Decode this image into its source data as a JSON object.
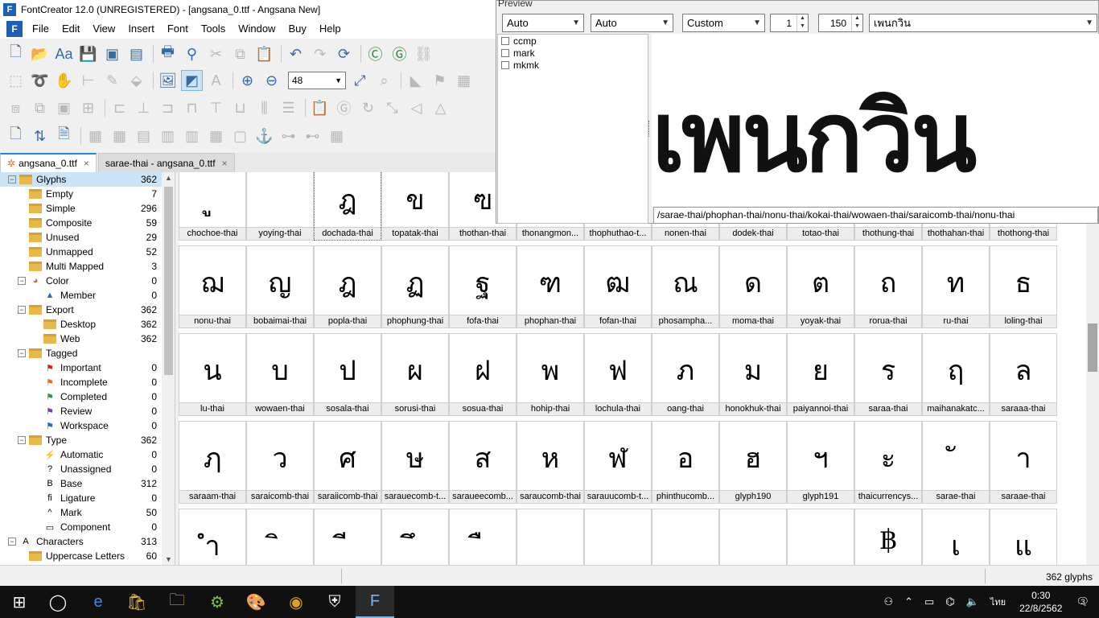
{
  "window": {
    "title": "FontCreator 12.0 (UNREGISTERED) - [angsana_0.ttf - Angsana New]"
  },
  "menu": [
    "File",
    "Edit",
    "View",
    "Insert",
    "Font",
    "Tools",
    "Window",
    "Buy",
    "Help"
  ],
  "toolbar": {
    "zoom": "48"
  },
  "tabs": [
    {
      "label": "angsana_0.ttf",
      "close": "×"
    },
    {
      "label": "sarae-thai - angsana_0.ttf",
      "close": "×"
    }
  ],
  "tree": [
    {
      "label": "Glyphs",
      "count": "362",
      "level": 1,
      "exp": "−",
      "icon": "folder",
      "sel": true
    },
    {
      "label": "Empty",
      "count": "7",
      "level": 2,
      "icon": "folder"
    },
    {
      "label": "Simple",
      "count": "296",
      "level": 2,
      "icon": "folder"
    },
    {
      "label": "Composite",
      "count": "59",
      "level": 2,
      "icon": "folder"
    },
    {
      "label": "Unused",
      "count": "29",
      "level": 2,
      "icon": "folder"
    },
    {
      "label": "Unmapped",
      "count": "52",
      "level": 2,
      "icon": "folder"
    },
    {
      "label": "Multi Mapped",
      "count": "3",
      "level": 2,
      "icon": "folder"
    },
    {
      "label": "Color",
      "count": "0",
      "level": 2,
      "exp": "−",
      "icon": "color-wheel"
    },
    {
      "label": "Member",
      "count": "0",
      "level": 3,
      "icon": "triangle"
    },
    {
      "label": "Export",
      "count": "362",
      "level": 2,
      "exp": "−",
      "icon": "folder"
    },
    {
      "label": "Desktop",
      "count": "362",
      "level": 3,
      "icon": "folder"
    },
    {
      "label": "Web",
      "count": "362",
      "level": 3,
      "icon": "folder"
    },
    {
      "label": "Tagged",
      "count": "",
      "level": 2,
      "exp": "−",
      "icon": "folder"
    },
    {
      "label": "Important",
      "count": "0",
      "level": 3,
      "icon": "flag-red"
    },
    {
      "label": "Incomplete",
      "count": "0",
      "level": 3,
      "icon": "flag-orange"
    },
    {
      "label": "Completed",
      "count": "0",
      "level": 3,
      "icon": "flag-green"
    },
    {
      "label": "Review",
      "count": "0",
      "level": 3,
      "icon": "flag-purple"
    },
    {
      "label": "Workspace",
      "count": "0",
      "level": 3,
      "icon": "flag-blue"
    },
    {
      "label": "Type",
      "count": "362",
      "level": 2,
      "exp": "−",
      "icon": "folder"
    },
    {
      "label": "Automatic",
      "count": "0",
      "level": 3,
      "icon": "bolt"
    },
    {
      "label": "Unassigned",
      "count": "0",
      "level": 3,
      "icon": "question"
    },
    {
      "label": "Base",
      "count": "312",
      "level": 3,
      "icon": "base"
    },
    {
      "label": "Ligature",
      "count": "0",
      "level": 3,
      "icon": "ligature"
    },
    {
      "label": "Mark",
      "count": "50",
      "level": 3,
      "icon": "caret"
    },
    {
      "label": "Component",
      "count": "0",
      "level": 3,
      "icon": "component"
    },
    {
      "label": "Characters",
      "count": "313",
      "level": 1,
      "exp": "−",
      "icon": "letter-a"
    },
    {
      "label": "Uppercase Letters",
      "count": "60",
      "level": 2,
      "icon": "folder"
    }
  ],
  "grid": {
    "rows": [
      [
        {
          "g": "ู",
          "n": "chochoe-thai"
        },
        {
          "g": "",
          "n": "yoying-thai"
        },
        {
          "g": "ฎ",
          "n": "dochada-thai",
          "sel": true
        },
        {
          "g": "ข",
          "n": "topatak-thai"
        },
        {
          "g": "ฃ",
          "n": "thothan-thai"
        },
        {
          "g": "",
          "n": "thonangmon..."
        },
        {
          "g": "",
          "n": "thophuthao-t..."
        },
        {
          "g": "",
          "n": "nonen-thai"
        },
        {
          "g": "",
          "n": "dodek-thai"
        },
        {
          "g": "",
          "n": "totao-thai"
        },
        {
          "g": "",
          "n": "thothung-thai"
        },
        {
          "g": "",
          "n": "thothahan-thai"
        },
        {
          "g": "",
          "n": "thothong-thai"
        }
      ],
      [
        {
          "g": "ฌ",
          "n": "nonu-thai"
        },
        {
          "g": "ญ",
          "n": "bobaimai-thai"
        },
        {
          "g": "ฎ",
          "n": "popla-thai"
        },
        {
          "g": "ฏ",
          "n": "phophung-thai"
        },
        {
          "g": "ฐ",
          "n": "fofa-thai"
        },
        {
          "g": "ฑ",
          "n": "phophan-thai"
        },
        {
          "g": "ฒ",
          "n": "fofan-thai"
        },
        {
          "g": "ณ",
          "n": "phosampha..."
        },
        {
          "g": "ด",
          "n": "moma-thai"
        },
        {
          "g": "ต",
          "n": "yoyak-thai"
        },
        {
          "g": "ถ",
          "n": "rorua-thai"
        },
        {
          "g": "ท",
          "n": "ru-thai"
        },
        {
          "g": "ธ",
          "n": "loling-thai"
        }
      ],
      [
        {
          "g": "น",
          "n": "lu-thai"
        },
        {
          "g": "บ",
          "n": "wowaen-thai"
        },
        {
          "g": "ป",
          "n": "sosala-thai"
        },
        {
          "g": "ผ",
          "n": "sorusi-thai"
        },
        {
          "g": "ฝ",
          "n": "sosua-thai"
        },
        {
          "g": "พ",
          "n": "hohip-thai"
        },
        {
          "g": "ฟ",
          "n": "lochula-thai"
        },
        {
          "g": "ภ",
          "n": "oang-thai"
        },
        {
          "g": "ม",
          "n": "honokhuk-thai"
        },
        {
          "g": "ย",
          "n": "paiyannoi-thai"
        },
        {
          "g": "ร",
          "n": "saraa-thai"
        },
        {
          "g": "ฤ",
          "n": "maihanakatc..."
        },
        {
          "g": "ล",
          "n": "saraaa-thai"
        }
      ],
      [
        {
          "g": "ฦ",
          "n": "saraam-thai"
        },
        {
          "g": "ว",
          "n": "saraicomb-thai"
        },
        {
          "g": "ศ",
          "n": "saraiicomb-thai"
        },
        {
          "g": "ษ",
          "n": "sarauecomb-t..."
        },
        {
          "g": "ส",
          "n": "saraueecomb..."
        },
        {
          "g": "ห",
          "n": "saraucomb-thai"
        },
        {
          "g": "ฬ",
          "n": "sarauucomb-t..."
        },
        {
          "g": "อ",
          "n": "phinthucomb..."
        },
        {
          "g": "ฮ",
          "n": "glyph190"
        },
        {
          "g": "ฯ",
          "n": "glyph191"
        },
        {
          "g": "ะ",
          "n": "thaicurrencys..."
        },
        {
          "g": "ั",
          "n": "sarae-thai"
        },
        {
          "g": "า",
          "n": "saraae-thai"
        }
      ],
      [
        {
          "g": "ำ",
          "n": ""
        },
        {
          "g": "ิ",
          "n": ""
        },
        {
          "g": "ี",
          "n": ""
        },
        {
          "g": "ึ",
          "n": ""
        },
        {
          "g": "ื",
          "n": ""
        },
        {
          "g": "",
          "n": ""
        },
        {
          "g": "",
          "n": ""
        },
        {
          "g": "",
          "n": ""
        },
        {
          "g": "",
          "n": ""
        },
        {
          "g": "",
          "n": ""
        },
        {
          "g": "฿",
          "n": ""
        },
        {
          "g": "เ",
          "n": ""
        },
        {
          "g": "แ",
          "n": ""
        }
      ]
    ]
  },
  "preview": {
    "title": "Preview",
    "dd1": "Auto",
    "dd2": "Auto",
    "dd3": "Custom",
    "spin1": "1",
    "spin2": "150",
    "text": "เพนกวิน",
    "features": [
      "ccmp",
      "mark",
      "mkmk"
    ],
    "display": "เพนกวิน",
    "glyph_path": "/sarae-thai/phophan-thai/nonu-thai/kokai-thai/wowaen-thai/saraicomb-thai/nonu-thai"
  },
  "status": {
    "count": "362 glyphs"
  },
  "taskbar": {
    "time": "0:30",
    "date": "22/8/2562",
    "lang": "ไทย",
    "notif": "3"
  }
}
